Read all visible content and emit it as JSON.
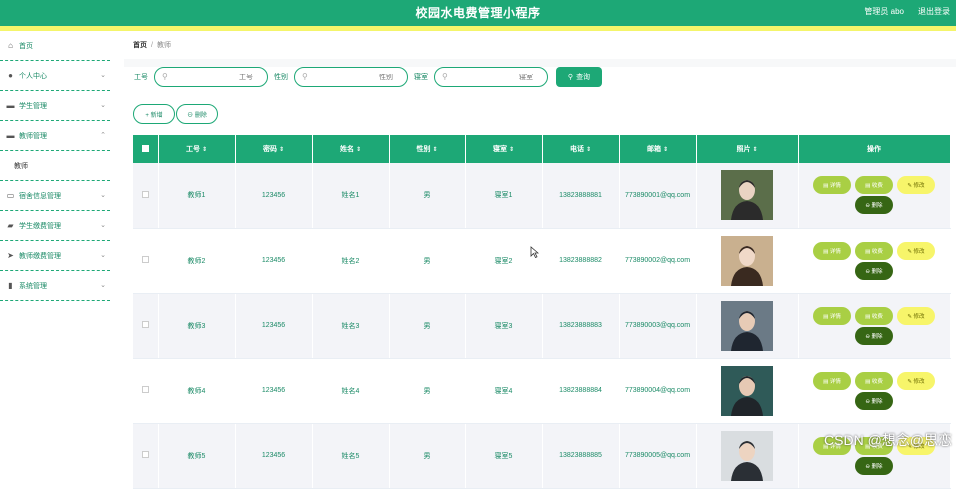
{
  "header": {
    "title": "校园水电费管理小程序",
    "user": "管理员 abo",
    "logout": "退出登录"
  },
  "sidebar": {
    "items": [
      {
        "label": "首页",
        "icon": "home-icon",
        "glyph": "⌂",
        "expandable": false
      },
      {
        "label": "个人中心",
        "icon": "user-icon",
        "glyph": "●",
        "expandable": true,
        "chev": "⌄"
      },
      {
        "label": "学生管理",
        "icon": "monitor-icon",
        "glyph": "▬",
        "expandable": true,
        "chev": "⌄"
      },
      {
        "label": "教师管理",
        "icon": "monitor-icon",
        "glyph": "▬",
        "expandable": true,
        "chev": "⌃"
      }
    ],
    "sub_item": "教师",
    "items2": [
      {
        "label": "宿舍信息管理",
        "icon": "chat-icon",
        "glyph": "▭",
        "chev": "⌄"
      },
      {
        "label": "学生缴费管理",
        "icon": "bag-icon",
        "glyph": "▰",
        "chev": "⌄"
      },
      {
        "label": "教师缴费管理",
        "icon": "send-icon",
        "glyph": "➤",
        "chev": "⌄"
      },
      {
        "label": "系统管理",
        "icon": "chart-icon",
        "glyph": "▮",
        "chev": "⌄"
      }
    ]
  },
  "breadcrumb": {
    "home": "首页",
    "sep": "/",
    "current": "教师"
  },
  "search": {
    "label_id": "工号",
    "placeholder_id": "工号",
    "label_gender": "性别",
    "placeholder_gender": "性别",
    "label_dorm": "寝室",
    "placeholder_dorm": "寝室",
    "query": "查询",
    "search_glyph": "⚲",
    "query_glyph": "⚲"
  },
  "actions": {
    "add": "+ 新增",
    "delete": "⊖ 删除"
  },
  "table": {
    "headers": [
      "工号",
      "密码",
      "姓名",
      "性别",
      "寝室",
      "电话",
      "邮箱",
      "照片",
      "操作"
    ],
    "sort_glyph": "⇕",
    "rows": [
      {
        "id": "教师1",
        "password": "123456",
        "name": "姓名1",
        "gender": "男",
        "dorm": "寝室1",
        "phone": "13823888881",
        "email": "773890001@qq.com"
      },
      {
        "id": "教师2",
        "password": "123456",
        "name": "姓名2",
        "gender": "男",
        "dorm": "寝室2",
        "phone": "13823888882",
        "email": "773890002@qq.com"
      },
      {
        "id": "教师3",
        "password": "123456",
        "name": "姓名3",
        "gender": "男",
        "dorm": "寝室3",
        "phone": "13823888883",
        "email": "773890003@qq.com"
      },
      {
        "id": "教师4",
        "password": "123456",
        "name": "姓名4",
        "gender": "男",
        "dorm": "寝室4",
        "phone": "13823888884",
        "email": "773890004@qq.com"
      },
      {
        "id": "教师5",
        "password": "123456",
        "name": "姓名5",
        "gender": "男",
        "dorm": "寝室5",
        "phone": "13823888885",
        "email": "773890005@qq.com"
      }
    ],
    "ops": {
      "detail": "▤ 详情",
      "collect": "▤ 收费",
      "edit": "✎ 修改",
      "remove": "⊖ 删除"
    }
  },
  "watermark": "CSDN @想念@思恋",
  "colors": {
    "primary": "#1da876",
    "accent_yellow": "#f4f56b",
    "op_green": "#a9cf44",
    "op_dark": "#366614"
  }
}
